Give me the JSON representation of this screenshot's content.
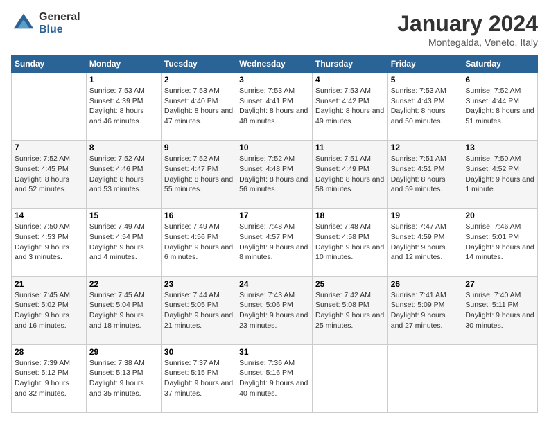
{
  "logo": {
    "general": "General",
    "blue": "Blue"
  },
  "header": {
    "title": "January 2024",
    "location": "Montegalda, Veneto, Italy"
  },
  "days_of_week": [
    "Sunday",
    "Monday",
    "Tuesday",
    "Wednesday",
    "Thursday",
    "Friday",
    "Saturday"
  ],
  "weeks": [
    [
      {
        "day": "",
        "sunrise": "",
        "sunset": "",
        "daylight": ""
      },
      {
        "day": "1",
        "sunrise": "Sunrise: 7:53 AM",
        "sunset": "Sunset: 4:39 PM",
        "daylight": "Daylight: 8 hours and 46 minutes."
      },
      {
        "day": "2",
        "sunrise": "Sunrise: 7:53 AM",
        "sunset": "Sunset: 4:40 PM",
        "daylight": "Daylight: 8 hours and 47 minutes."
      },
      {
        "day": "3",
        "sunrise": "Sunrise: 7:53 AM",
        "sunset": "Sunset: 4:41 PM",
        "daylight": "Daylight: 8 hours and 48 minutes."
      },
      {
        "day": "4",
        "sunrise": "Sunrise: 7:53 AM",
        "sunset": "Sunset: 4:42 PM",
        "daylight": "Daylight: 8 hours and 49 minutes."
      },
      {
        "day": "5",
        "sunrise": "Sunrise: 7:53 AM",
        "sunset": "Sunset: 4:43 PM",
        "daylight": "Daylight: 8 hours and 50 minutes."
      },
      {
        "day": "6",
        "sunrise": "Sunrise: 7:52 AM",
        "sunset": "Sunset: 4:44 PM",
        "daylight": "Daylight: 8 hours and 51 minutes."
      }
    ],
    [
      {
        "day": "7",
        "sunrise": "Sunrise: 7:52 AM",
        "sunset": "Sunset: 4:45 PM",
        "daylight": "Daylight: 8 hours and 52 minutes."
      },
      {
        "day": "8",
        "sunrise": "Sunrise: 7:52 AM",
        "sunset": "Sunset: 4:46 PM",
        "daylight": "Daylight: 8 hours and 53 minutes."
      },
      {
        "day": "9",
        "sunrise": "Sunrise: 7:52 AM",
        "sunset": "Sunset: 4:47 PM",
        "daylight": "Daylight: 8 hours and 55 minutes."
      },
      {
        "day": "10",
        "sunrise": "Sunrise: 7:52 AM",
        "sunset": "Sunset: 4:48 PM",
        "daylight": "Daylight: 8 hours and 56 minutes."
      },
      {
        "day": "11",
        "sunrise": "Sunrise: 7:51 AM",
        "sunset": "Sunset: 4:49 PM",
        "daylight": "Daylight: 8 hours and 58 minutes."
      },
      {
        "day": "12",
        "sunrise": "Sunrise: 7:51 AM",
        "sunset": "Sunset: 4:51 PM",
        "daylight": "Daylight: 8 hours and 59 minutes."
      },
      {
        "day": "13",
        "sunrise": "Sunrise: 7:50 AM",
        "sunset": "Sunset: 4:52 PM",
        "daylight": "Daylight: 9 hours and 1 minute."
      }
    ],
    [
      {
        "day": "14",
        "sunrise": "Sunrise: 7:50 AM",
        "sunset": "Sunset: 4:53 PM",
        "daylight": "Daylight: 9 hours and 3 minutes."
      },
      {
        "day": "15",
        "sunrise": "Sunrise: 7:49 AM",
        "sunset": "Sunset: 4:54 PM",
        "daylight": "Daylight: 9 hours and 4 minutes."
      },
      {
        "day": "16",
        "sunrise": "Sunrise: 7:49 AM",
        "sunset": "Sunset: 4:56 PM",
        "daylight": "Daylight: 9 hours and 6 minutes."
      },
      {
        "day": "17",
        "sunrise": "Sunrise: 7:48 AM",
        "sunset": "Sunset: 4:57 PM",
        "daylight": "Daylight: 9 hours and 8 minutes."
      },
      {
        "day": "18",
        "sunrise": "Sunrise: 7:48 AM",
        "sunset": "Sunset: 4:58 PM",
        "daylight": "Daylight: 9 hours and 10 minutes."
      },
      {
        "day": "19",
        "sunrise": "Sunrise: 7:47 AM",
        "sunset": "Sunset: 4:59 PM",
        "daylight": "Daylight: 9 hours and 12 minutes."
      },
      {
        "day": "20",
        "sunrise": "Sunrise: 7:46 AM",
        "sunset": "Sunset: 5:01 PM",
        "daylight": "Daylight: 9 hours and 14 minutes."
      }
    ],
    [
      {
        "day": "21",
        "sunrise": "Sunrise: 7:45 AM",
        "sunset": "Sunset: 5:02 PM",
        "daylight": "Daylight: 9 hours and 16 minutes."
      },
      {
        "day": "22",
        "sunrise": "Sunrise: 7:45 AM",
        "sunset": "Sunset: 5:04 PM",
        "daylight": "Daylight: 9 hours and 18 minutes."
      },
      {
        "day": "23",
        "sunrise": "Sunrise: 7:44 AM",
        "sunset": "Sunset: 5:05 PM",
        "daylight": "Daylight: 9 hours and 21 minutes."
      },
      {
        "day": "24",
        "sunrise": "Sunrise: 7:43 AM",
        "sunset": "Sunset: 5:06 PM",
        "daylight": "Daylight: 9 hours and 23 minutes."
      },
      {
        "day": "25",
        "sunrise": "Sunrise: 7:42 AM",
        "sunset": "Sunset: 5:08 PM",
        "daylight": "Daylight: 9 hours and 25 minutes."
      },
      {
        "day": "26",
        "sunrise": "Sunrise: 7:41 AM",
        "sunset": "Sunset: 5:09 PM",
        "daylight": "Daylight: 9 hours and 27 minutes."
      },
      {
        "day": "27",
        "sunrise": "Sunrise: 7:40 AM",
        "sunset": "Sunset: 5:11 PM",
        "daylight": "Daylight: 9 hours and 30 minutes."
      }
    ],
    [
      {
        "day": "28",
        "sunrise": "Sunrise: 7:39 AM",
        "sunset": "Sunset: 5:12 PM",
        "daylight": "Daylight: 9 hours and 32 minutes."
      },
      {
        "day": "29",
        "sunrise": "Sunrise: 7:38 AM",
        "sunset": "Sunset: 5:13 PM",
        "daylight": "Daylight: 9 hours and 35 minutes."
      },
      {
        "day": "30",
        "sunrise": "Sunrise: 7:37 AM",
        "sunset": "Sunset: 5:15 PM",
        "daylight": "Daylight: 9 hours and 37 minutes."
      },
      {
        "day": "31",
        "sunrise": "Sunrise: 7:36 AM",
        "sunset": "Sunset: 5:16 PM",
        "daylight": "Daylight: 9 hours and 40 minutes."
      },
      {
        "day": "",
        "sunrise": "",
        "sunset": "",
        "daylight": ""
      },
      {
        "day": "",
        "sunrise": "",
        "sunset": "",
        "daylight": ""
      },
      {
        "day": "",
        "sunrise": "",
        "sunset": "",
        "daylight": ""
      }
    ]
  ]
}
